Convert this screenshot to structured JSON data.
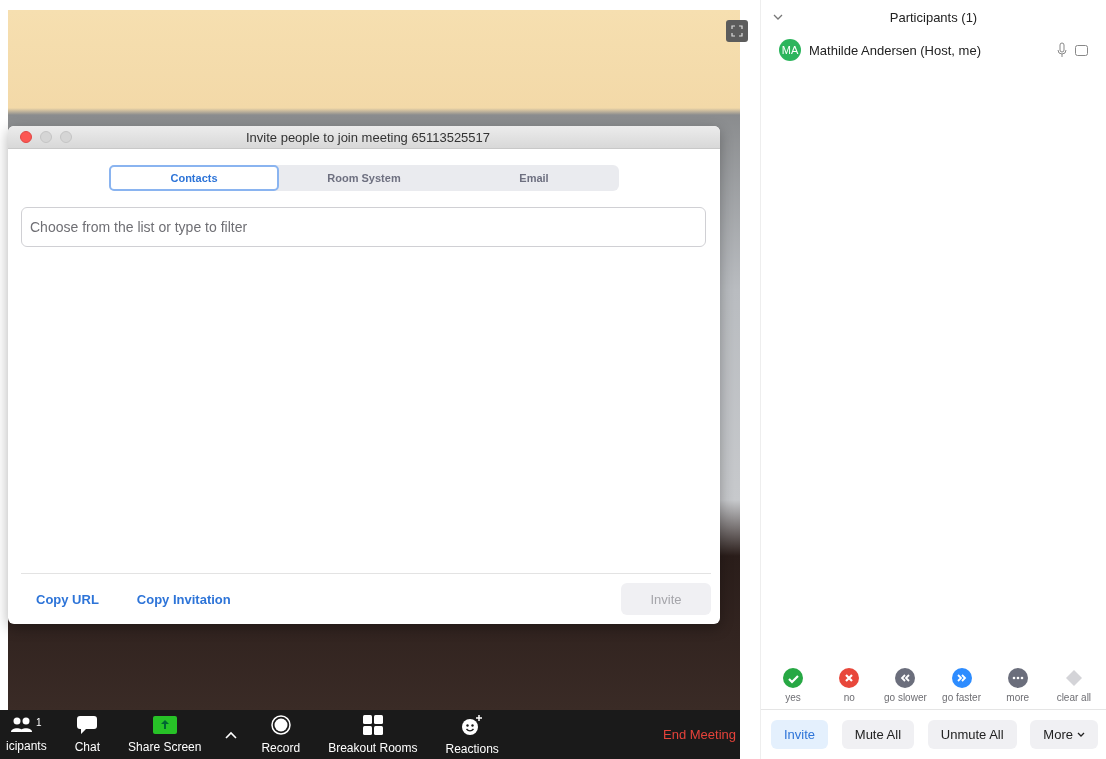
{
  "dialog": {
    "title": "Invite people to join meeting 65113525517",
    "tabs": [
      {
        "label": "Contacts",
        "selected": true
      },
      {
        "label": "Room System",
        "selected": false
      },
      {
        "label": "Email",
        "selected": false
      }
    ],
    "search": {
      "placeholder": "Choose from the list or type to filter"
    },
    "links": [
      "Copy URL",
      "Copy Invitation"
    ],
    "invite_button": {
      "label": "Invite",
      "disabled": true
    }
  },
  "toolbar": {
    "items": [
      {
        "kind": "participants",
        "label": "icipants",
        "count": "1"
      },
      {
        "kind": "chat",
        "label": "Chat"
      },
      {
        "kind": "share",
        "label": "Share Screen"
      },
      {
        "kind": "caret"
      },
      {
        "kind": "record",
        "label": "Record"
      },
      {
        "kind": "breakout",
        "label": "Breakout Rooms"
      },
      {
        "kind": "reactions",
        "label": "Reactions"
      }
    ],
    "end_button": "End Meeting"
  },
  "panel": {
    "title": "Participants (1)",
    "participants": [
      {
        "initials": "MA",
        "name": "Mathilde Andersen (Host, me)",
        "color": "#2db55d"
      }
    ],
    "reactions": [
      {
        "kind": "yes",
        "label": "yes",
        "color": "#27a844"
      },
      {
        "kind": "no",
        "label": "no",
        "color": "#e8473b"
      },
      {
        "kind": "slower",
        "label": "go slower",
        "color": "#6b6e7c"
      },
      {
        "kind": "faster",
        "label": "go faster",
        "color": "#2d8cff"
      },
      {
        "kind": "more",
        "label": "more",
        "color": "#6b6e7c"
      },
      {
        "kind": "clear",
        "label": "clear all",
        "color": "#d4d4d8"
      }
    ],
    "buttons": [
      {
        "label": "Invite",
        "kind": "primary"
      },
      {
        "label": "Mute All",
        "kind": "plain"
      },
      {
        "label": "Unmute All",
        "kind": "plain"
      },
      {
        "label": "More",
        "kind": "menu"
      }
    ]
  }
}
